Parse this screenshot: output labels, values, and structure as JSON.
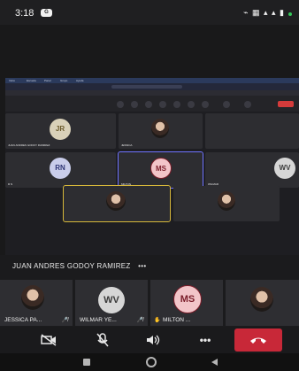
{
  "status_bar": {
    "time": "3:18",
    "app_badge": "G"
  },
  "shared_screen": {
    "menu": [
      "Inicio",
      "Escuela",
      "Panel",
      "Grupo",
      "Ayuda"
    ],
    "tiles": [
      {
        "initials": "JR",
        "label": "JUAN ANDRES GODOY RAMIREZ",
        "color": "#d9d1b9",
        "text": "#6b5a2b"
      },
      {
        "initials": "",
        "label": "JESSICA",
        "photo": true
      },
      {
        "initials": "",
        "label": "",
        "photo": false
      },
      {
        "initials": "RN",
        "label": "R N",
        "color": "#c9cdea",
        "text": "#2f3675"
      },
      {
        "initials": "MS",
        "label": "MILTON",
        "color": "#f2c5c9",
        "text": "#7a1d2a"
      },
      {
        "initials": "WV",
        "label": "WILMAR",
        "color": "#d6d6d6",
        "text": "#3a3a3a"
      },
      {
        "initials": "",
        "label": "",
        "photo": true
      },
      {
        "initials": "",
        "label": "",
        "photo": true
      }
    ]
  },
  "speaker_name": "JUAN ANDRES GODOY RAMIREZ",
  "speaker_more": "•••",
  "participants": [
    {
      "name": "JESSICA PA...",
      "initials": "",
      "photo": true,
      "mic": "muted"
    },
    {
      "name": "WILMAR YE...",
      "initials": "WV",
      "photo": false,
      "color": "#d6d6d6",
      "text": "#3a3a3a",
      "mic": "muted"
    },
    {
      "name": "MILTON ...",
      "initials": "MS",
      "photo": false,
      "color": "#f2c5c9",
      "text": "#7a1d2a",
      "mic": "hand"
    },
    {
      "name": "",
      "initials": "",
      "photo": true,
      "mic": ""
    }
  ],
  "controls": {
    "camera": "camera-off-icon",
    "mic": "mic-off-icon",
    "speaker": "speaker-icon",
    "more": "•••",
    "end": "end-call-icon"
  },
  "colors": {
    "end_call": "#c82838",
    "active_border": "#d6b73a",
    "ms_border": "#6f73ff"
  }
}
